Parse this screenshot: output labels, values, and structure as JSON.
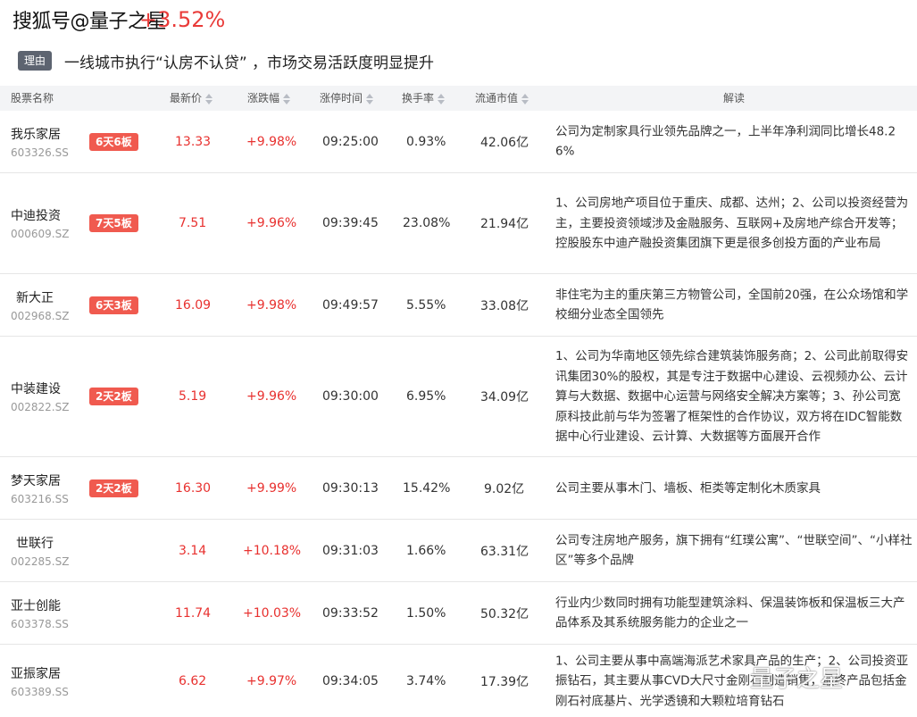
{
  "watermark_top": "搜狐号@量子之星",
  "top_change": "+3.52%",
  "reason": {
    "tag": "理由",
    "text": "一线城市执行“认房不认贷” ，市场交易活跃度明显提升"
  },
  "headers": {
    "name": "股票名称",
    "price": "最新价",
    "change": "涨跌幅",
    "time": "涨停时间",
    "turnover": "换手率",
    "cap": "流通市值",
    "desc": "解读"
  },
  "colors": {
    "up_red": "#e8312f",
    "badge_red": "#f05a4f",
    "tag_gray": "#5d6470"
  },
  "rows": [
    {
      "name": "我乐家居",
      "code": "603326.SS",
      "badge": "6天6板",
      "price": "13.33",
      "change": "+9.98%",
      "time": "09:25:00",
      "turnover": "0.93%",
      "cap": "42.06亿",
      "desc": "公司为定制家具行业领先品牌之一，上半年净利润同比增长48.26%"
    },
    {
      "name": "中迪投资",
      "code": "000609.SZ",
      "badge": "7天5板",
      "price": "7.51",
      "change": "+9.96%",
      "time": "09:39:45",
      "turnover": "23.08%",
      "cap": "21.94亿",
      "desc": "1、公司房地产项目位于重庆、成都、达州；2、公司以投资经营为主，主要投资领域涉及金融服务、互联网+及房地产综合开发等；控股股东中迪产融投资集团旗下更是很多创投方面的产业布局"
    },
    {
      "name": "新大正",
      "code": "002968.SZ",
      "badge": "6天3板",
      "price": "16.09",
      "change": "+9.98%",
      "time": "09:49:57",
      "turnover": "5.55%",
      "cap": "33.08亿",
      "desc": "非住宅为主的重庆第三方物管公司，全国前20强，在公众场馆和学校细分业态全国领先"
    },
    {
      "name": "中装建设",
      "code": "002822.SZ",
      "badge": "2天2板",
      "price": "5.19",
      "change": "+9.96%",
      "time": "09:30:00",
      "turnover": "6.95%",
      "cap": "34.09亿",
      "desc": "1、公司为华南地区领先综合建筑装饰服务商；2、公司此前取得安讯集团30%的股权，其是专注于数据中心建设、云视频办公、云计算与大数据、数据中心运营与网络安全解决方案等；3、孙公司宽原科技此前与华为签署了框架性的合作协议，双方将在IDC智能数据中心行业建设、云计算、大数据等方面展开合作"
    },
    {
      "name": "梦天家居",
      "code": "603216.SS",
      "badge": "2天2板",
      "price": "16.30",
      "change": "+9.99%",
      "time": "09:30:13",
      "turnover": "15.42%",
      "cap": "9.02亿",
      "desc": "公司主要从事木门、墙板、柜类等定制化木质家具"
    },
    {
      "name": "世联行",
      "code": "002285.SZ",
      "badge": "",
      "price": "3.14",
      "change": "+10.18%",
      "time": "09:31:03",
      "turnover": "1.66%",
      "cap": "63.31亿",
      "desc": "公司专注房地产服务，旗下拥有“红璞公寓”、“世联空间”、“小样社区”等多个品牌"
    },
    {
      "name": "亚士创能",
      "code": "603378.SS",
      "badge": "",
      "price": "11.74",
      "change": "+10.03%",
      "time": "09:33:52",
      "turnover": "1.50%",
      "cap": "50.32亿",
      "desc": "行业内少数同时拥有功能型建筑涂料、保温装饰板和保温板三大产品体系及其系统服务能力的企业之一"
    },
    {
      "name": "亚振家居",
      "code": "603389.SS",
      "badge": "",
      "price": "6.62",
      "change": "+9.97%",
      "time": "09:34:05",
      "turnover": "3.74%",
      "cap": "17.39亿",
      "desc": "1、公司主要从事中高端海派艺术家具产品的生产；2、公司投资亚振钻石，其主要从事CVD大尺寸金刚石制造销售，最终产品包括金刚石衬底基片、光学透镜和大颗粒培育钻石"
    }
  ],
  "watermark_bottom": "量子之星"
}
